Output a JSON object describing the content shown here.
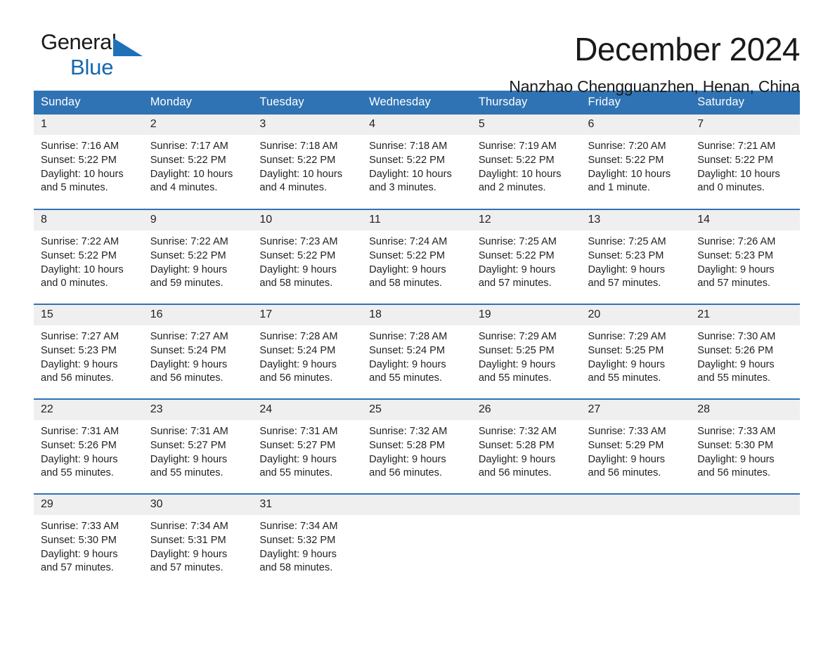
{
  "brand": {
    "name_part1": "General",
    "name_part2": "Blue",
    "accent_color": "#2f73b4"
  },
  "header": {
    "title": "December 2024",
    "subtitle": "Nanzhao Chengguanzhen, Henan, China"
  },
  "calendar": {
    "weekday_headers": [
      "Sunday",
      "Monday",
      "Tuesday",
      "Wednesday",
      "Thursday",
      "Friday",
      "Saturday"
    ],
    "weeks": [
      [
        {
          "day": "1",
          "sunrise": "Sunrise: 7:16 AM",
          "sunset": "Sunset: 5:22 PM",
          "daylight_line1": "Daylight: 10 hours",
          "daylight_line2": "and 5 minutes."
        },
        {
          "day": "2",
          "sunrise": "Sunrise: 7:17 AM",
          "sunset": "Sunset: 5:22 PM",
          "daylight_line1": "Daylight: 10 hours",
          "daylight_line2": "and 4 minutes."
        },
        {
          "day": "3",
          "sunrise": "Sunrise: 7:18 AM",
          "sunset": "Sunset: 5:22 PM",
          "daylight_line1": "Daylight: 10 hours",
          "daylight_line2": "and 4 minutes."
        },
        {
          "day": "4",
          "sunrise": "Sunrise: 7:18 AM",
          "sunset": "Sunset: 5:22 PM",
          "daylight_line1": "Daylight: 10 hours",
          "daylight_line2": "and 3 minutes."
        },
        {
          "day": "5",
          "sunrise": "Sunrise: 7:19 AM",
          "sunset": "Sunset: 5:22 PM",
          "daylight_line1": "Daylight: 10 hours",
          "daylight_line2": "and 2 minutes."
        },
        {
          "day": "6",
          "sunrise": "Sunrise: 7:20 AM",
          "sunset": "Sunset: 5:22 PM",
          "daylight_line1": "Daylight: 10 hours",
          "daylight_line2": "and 1 minute."
        },
        {
          "day": "7",
          "sunrise": "Sunrise: 7:21 AM",
          "sunset": "Sunset: 5:22 PM",
          "daylight_line1": "Daylight: 10 hours",
          "daylight_line2": "and 0 minutes."
        }
      ],
      [
        {
          "day": "8",
          "sunrise": "Sunrise: 7:22 AM",
          "sunset": "Sunset: 5:22 PM",
          "daylight_line1": "Daylight: 10 hours",
          "daylight_line2": "and 0 minutes."
        },
        {
          "day": "9",
          "sunrise": "Sunrise: 7:22 AM",
          "sunset": "Sunset: 5:22 PM",
          "daylight_line1": "Daylight: 9 hours",
          "daylight_line2": "and 59 minutes."
        },
        {
          "day": "10",
          "sunrise": "Sunrise: 7:23 AM",
          "sunset": "Sunset: 5:22 PM",
          "daylight_line1": "Daylight: 9 hours",
          "daylight_line2": "and 58 minutes."
        },
        {
          "day": "11",
          "sunrise": "Sunrise: 7:24 AM",
          "sunset": "Sunset: 5:22 PM",
          "daylight_line1": "Daylight: 9 hours",
          "daylight_line2": "and 58 minutes."
        },
        {
          "day": "12",
          "sunrise": "Sunrise: 7:25 AM",
          "sunset": "Sunset: 5:22 PM",
          "daylight_line1": "Daylight: 9 hours",
          "daylight_line2": "and 57 minutes."
        },
        {
          "day": "13",
          "sunrise": "Sunrise: 7:25 AM",
          "sunset": "Sunset: 5:23 PM",
          "daylight_line1": "Daylight: 9 hours",
          "daylight_line2": "and 57 minutes."
        },
        {
          "day": "14",
          "sunrise": "Sunrise: 7:26 AM",
          "sunset": "Sunset: 5:23 PM",
          "daylight_line1": "Daylight: 9 hours",
          "daylight_line2": "and 57 minutes."
        }
      ],
      [
        {
          "day": "15",
          "sunrise": "Sunrise: 7:27 AM",
          "sunset": "Sunset: 5:23 PM",
          "daylight_line1": "Daylight: 9 hours",
          "daylight_line2": "and 56 minutes."
        },
        {
          "day": "16",
          "sunrise": "Sunrise: 7:27 AM",
          "sunset": "Sunset: 5:24 PM",
          "daylight_line1": "Daylight: 9 hours",
          "daylight_line2": "and 56 minutes."
        },
        {
          "day": "17",
          "sunrise": "Sunrise: 7:28 AM",
          "sunset": "Sunset: 5:24 PM",
          "daylight_line1": "Daylight: 9 hours",
          "daylight_line2": "and 56 minutes."
        },
        {
          "day": "18",
          "sunrise": "Sunrise: 7:28 AM",
          "sunset": "Sunset: 5:24 PM",
          "daylight_line1": "Daylight: 9 hours",
          "daylight_line2": "and 55 minutes."
        },
        {
          "day": "19",
          "sunrise": "Sunrise: 7:29 AM",
          "sunset": "Sunset: 5:25 PM",
          "daylight_line1": "Daylight: 9 hours",
          "daylight_line2": "and 55 minutes."
        },
        {
          "day": "20",
          "sunrise": "Sunrise: 7:29 AM",
          "sunset": "Sunset: 5:25 PM",
          "daylight_line1": "Daylight: 9 hours",
          "daylight_line2": "and 55 minutes."
        },
        {
          "day": "21",
          "sunrise": "Sunrise: 7:30 AM",
          "sunset": "Sunset: 5:26 PM",
          "daylight_line1": "Daylight: 9 hours",
          "daylight_line2": "and 55 minutes."
        }
      ],
      [
        {
          "day": "22",
          "sunrise": "Sunrise: 7:31 AM",
          "sunset": "Sunset: 5:26 PM",
          "daylight_line1": "Daylight: 9 hours",
          "daylight_line2": "and 55 minutes."
        },
        {
          "day": "23",
          "sunrise": "Sunrise: 7:31 AM",
          "sunset": "Sunset: 5:27 PM",
          "daylight_line1": "Daylight: 9 hours",
          "daylight_line2": "and 55 minutes."
        },
        {
          "day": "24",
          "sunrise": "Sunrise: 7:31 AM",
          "sunset": "Sunset: 5:27 PM",
          "daylight_line1": "Daylight: 9 hours",
          "daylight_line2": "and 55 minutes."
        },
        {
          "day": "25",
          "sunrise": "Sunrise: 7:32 AM",
          "sunset": "Sunset: 5:28 PM",
          "daylight_line1": "Daylight: 9 hours",
          "daylight_line2": "and 56 minutes."
        },
        {
          "day": "26",
          "sunrise": "Sunrise: 7:32 AM",
          "sunset": "Sunset: 5:28 PM",
          "daylight_line1": "Daylight: 9 hours",
          "daylight_line2": "and 56 minutes."
        },
        {
          "day": "27",
          "sunrise": "Sunrise: 7:33 AM",
          "sunset": "Sunset: 5:29 PM",
          "daylight_line1": "Daylight: 9 hours",
          "daylight_line2": "and 56 minutes."
        },
        {
          "day": "28",
          "sunrise": "Sunrise: 7:33 AM",
          "sunset": "Sunset: 5:30 PM",
          "daylight_line1": "Daylight: 9 hours",
          "daylight_line2": "and 56 minutes."
        }
      ],
      [
        {
          "day": "29",
          "sunrise": "Sunrise: 7:33 AM",
          "sunset": "Sunset: 5:30 PM",
          "daylight_line1": "Daylight: 9 hours",
          "daylight_line2": "and 57 minutes."
        },
        {
          "day": "30",
          "sunrise": "Sunrise: 7:34 AM",
          "sunset": "Sunset: 5:31 PM",
          "daylight_line1": "Daylight: 9 hours",
          "daylight_line2": "and 57 minutes."
        },
        {
          "day": "31",
          "sunrise": "Sunrise: 7:34 AM",
          "sunset": "Sunset: 5:32 PM",
          "daylight_line1": "Daylight: 9 hours",
          "daylight_line2": "and 58 minutes."
        },
        {
          "day": "",
          "sunrise": "",
          "sunset": "",
          "daylight_line1": "",
          "daylight_line2": ""
        },
        {
          "day": "",
          "sunrise": "",
          "sunset": "",
          "daylight_line1": "",
          "daylight_line2": ""
        },
        {
          "day": "",
          "sunrise": "",
          "sunset": "",
          "daylight_line1": "",
          "daylight_line2": ""
        },
        {
          "day": "",
          "sunrise": "",
          "sunset": "",
          "daylight_line1": "",
          "daylight_line2": ""
        }
      ]
    ]
  }
}
